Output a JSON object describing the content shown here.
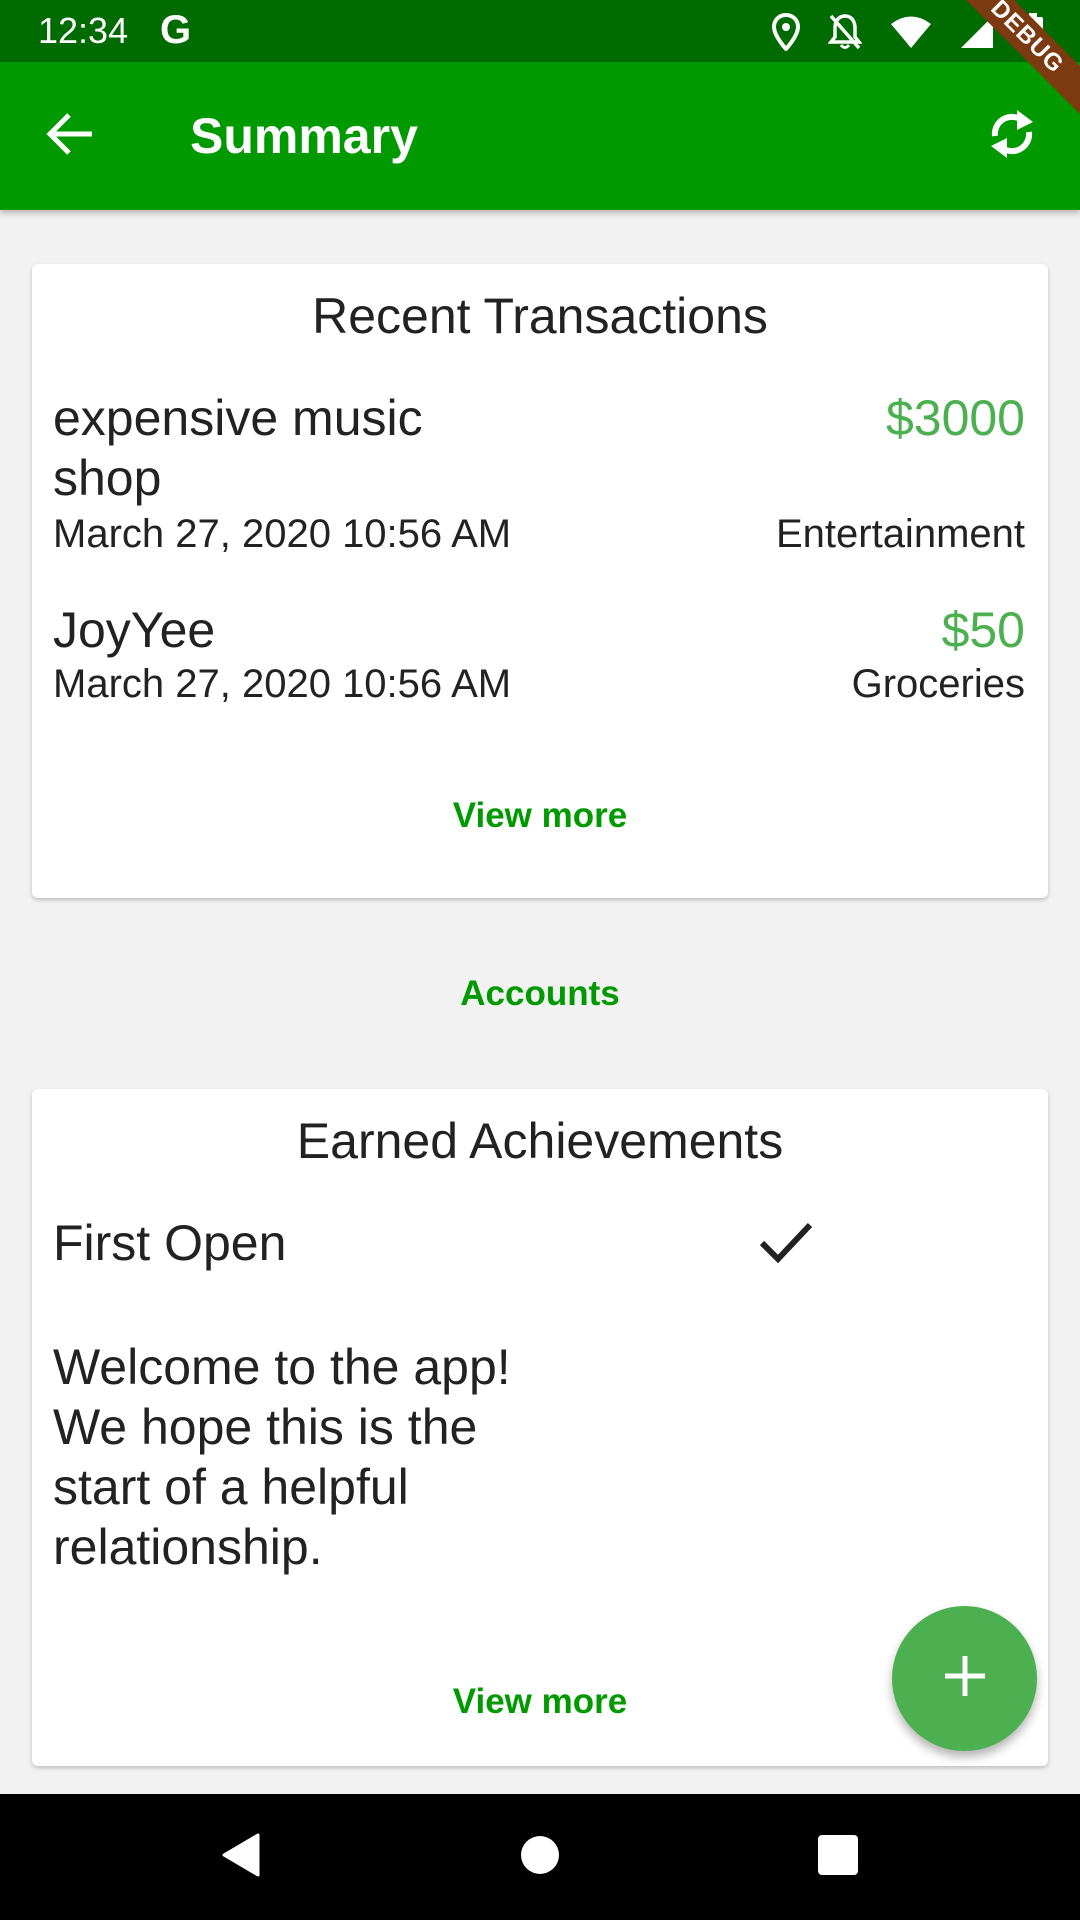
{
  "status_bar": {
    "time": "12:34",
    "g_label": "G",
    "icons": [
      "location-icon",
      "notifications-off-icon",
      "wifi-icon",
      "signal-icon",
      "battery-icon"
    ]
  },
  "debug_banner": "DEBUG",
  "app_bar": {
    "title": "Summary",
    "back_icon": "arrow-back-icon",
    "refresh_icon": "refresh-icon",
    "color": "#009900"
  },
  "recent_transactions": {
    "title": "Recent Transactions",
    "items": [
      {
        "name": "expensive music shop",
        "amount": "$3000",
        "date": "March 27, 2020 10:56 AM",
        "category": "Entertainment"
      },
      {
        "name": "JoyYee",
        "amount": "$50",
        "date": "March 27, 2020 10:56 AM",
        "category": "Groceries"
      }
    ],
    "view_more": "View more"
  },
  "accounts_link": "Accounts",
  "achievements": {
    "title": "Earned Achievements",
    "items": [
      {
        "name": "First Open",
        "earned_icon": "check-icon",
        "description": "Welcome to the app! We hope this is the start of a helpful relationship."
      }
    ],
    "view_more": "View more"
  },
  "fab": {
    "icon": "add-icon",
    "color": "#4caf50"
  },
  "nav_bar": {
    "icons": [
      "back-triangle-icon",
      "home-circle-icon",
      "recents-square-icon"
    ]
  },
  "colors": {
    "amount_green": "#4caf50",
    "link_green": "#009900",
    "status_bar": "#006b00"
  }
}
